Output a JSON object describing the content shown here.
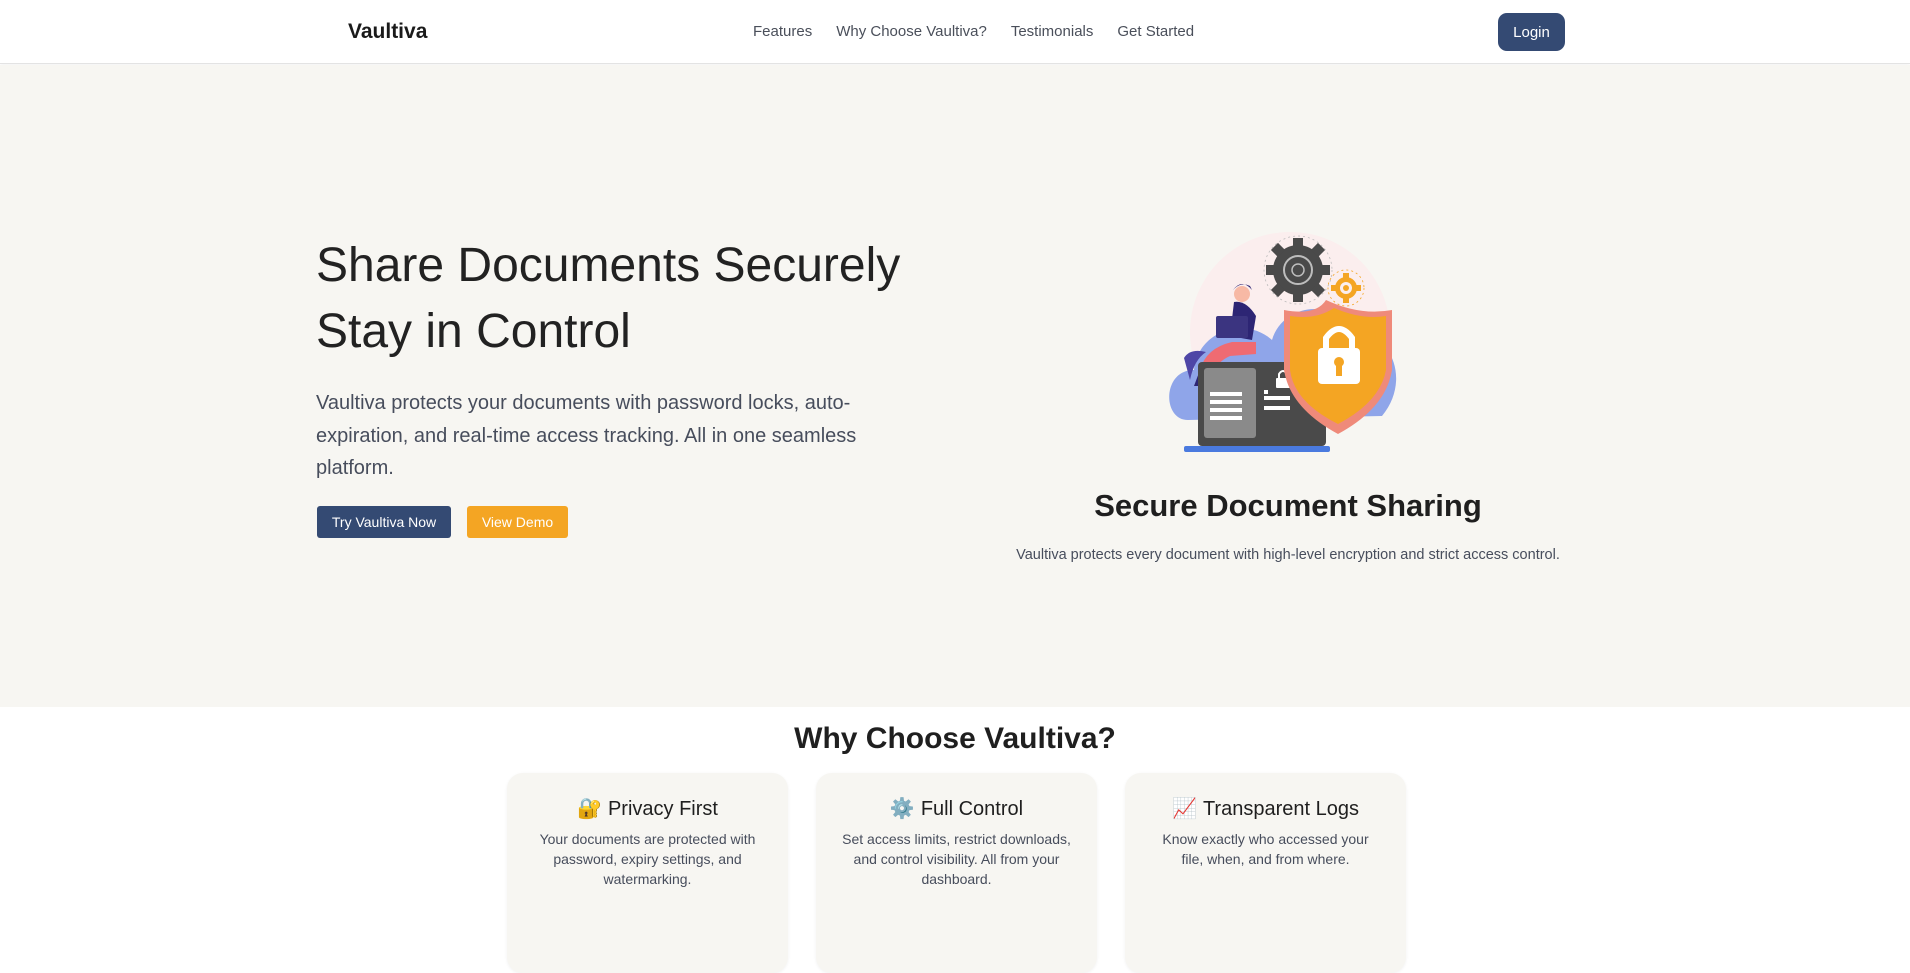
{
  "nav": {
    "brand": "Vaultiva",
    "links": [
      "Features",
      "Why Choose Vaultiva?",
      "Testimonials",
      "Get Started"
    ],
    "login_label": "Login"
  },
  "hero": {
    "title_line1": "Share Documents Securely",
    "title_line2": "Stay in Control",
    "description": "Vaultiva protects your documents with password locks, auto-expiration, and real-time access tracking. All in one seamless platform.",
    "primary_cta": "Try Vaultiva Now",
    "secondary_cta": "View Demo"
  },
  "showcase": {
    "illustration_icon": "secure-cloud-illustration",
    "title": "Secure Document Sharing",
    "text": "Vaultiva protects every document with high-level encryption and strict access control."
  },
  "why": {
    "title": "Why Choose Vaultiva?",
    "cards": [
      {
        "icon": "🔐",
        "title": "Privacy First",
        "text": "Your documents are protected with password, expiry settings, and watermarking."
      },
      {
        "icon": "⚙️",
        "title": "Full Control",
        "text": "Set access limits, restrict downloads, and control visibility. All from your dashboard."
      },
      {
        "icon": "📈",
        "title": "Transparent Logs",
        "text": "Know exactly who accessed your file, when, and from where."
      }
    ]
  },
  "colors": {
    "primary": "#344a73",
    "accent": "#f4a523",
    "hero_bg": "#f7f6f2"
  }
}
